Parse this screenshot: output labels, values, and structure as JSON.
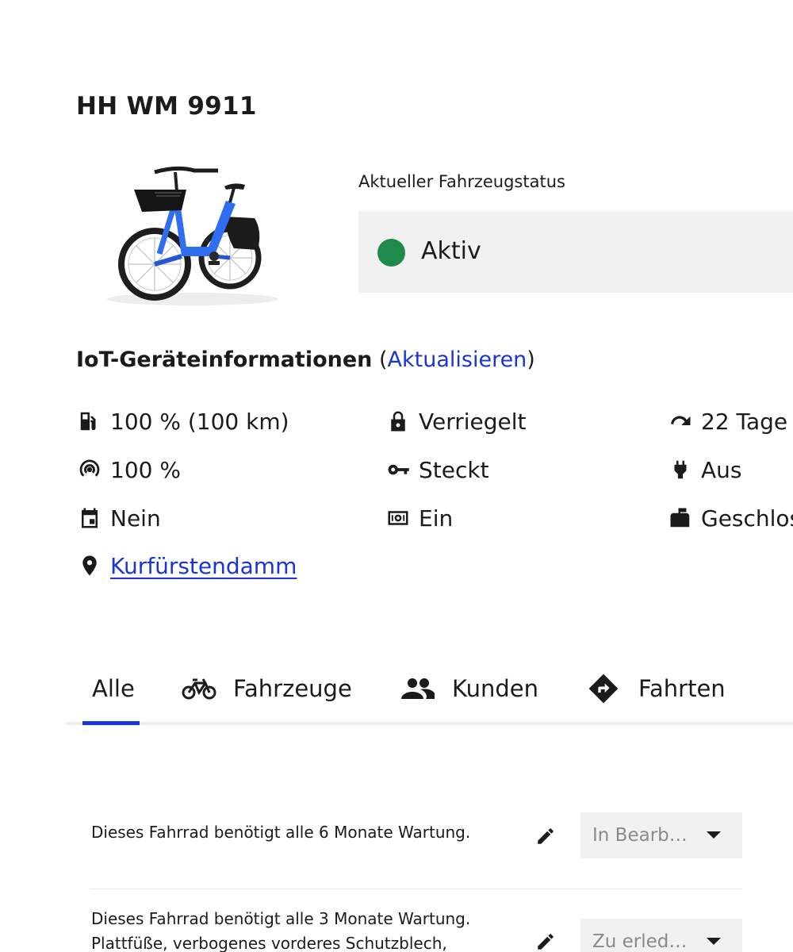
{
  "vehicle": {
    "plate": "HH WM 9911",
    "image": "blue-e-bike"
  },
  "status": {
    "label": "Aktueller Fahrzeugstatus",
    "value": "Aktiv",
    "color": "#1f8a4c"
  },
  "iot": {
    "title": "IoT-Geräteinformationen",
    "open_paren": "(",
    "refresh_link": "Aktualisieren",
    "close_paren": ")",
    "items": [
      {
        "icon": "fuel-battery-icon",
        "value": "100 % (100 km)"
      },
      {
        "icon": "lock-icon",
        "value": "Verriegelt"
      },
      {
        "icon": "redo-arrow-icon",
        "value": "22 Tage"
      },
      {
        "icon": "signal-icon",
        "value": "100 %"
      },
      {
        "icon": "key-icon",
        "value": "Steckt"
      },
      {
        "icon": "plug-icon",
        "value": "Aus"
      },
      {
        "icon": "calendar-icon",
        "value": "Nein"
      },
      {
        "icon": "alarm-icon",
        "value": "Ein"
      },
      {
        "icon": "mailbox-icon",
        "value": "Geschlossen"
      },
      {
        "icon": "location-pin-icon",
        "value": "Kurfürstendamm"
      }
    ]
  },
  "tabs": [
    {
      "label": "Alle",
      "icon": "",
      "active": true
    },
    {
      "label": "Fahrzeuge",
      "icon": "bike-icon",
      "active": false
    },
    {
      "label": "Kunden",
      "icon": "people-icon",
      "active": false
    },
    {
      "label": "Fahrten",
      "icon": "directions-icon",
      "active": false
    }
  ],
  "notes": [
    {
      "text": [
        "Dieses Fahrrad benötigt alle 6 Monate Wartung."
      ],
      "status": "In Bearb…"
    },
    {
      "text": [
        "Dieses Fahrrad benötigt alle 3 Monate Wartung.",
        "Plattfüße, verbogenes vorderes Schutzblech,"
      ],
      "status": "Zu erled…"
    }
  ],
  "colors": {
    "accent": "#1a35d6",
    "active_status": "#1f8a4c",
    "panel_bg": "#f1f1f1"
  }
}
